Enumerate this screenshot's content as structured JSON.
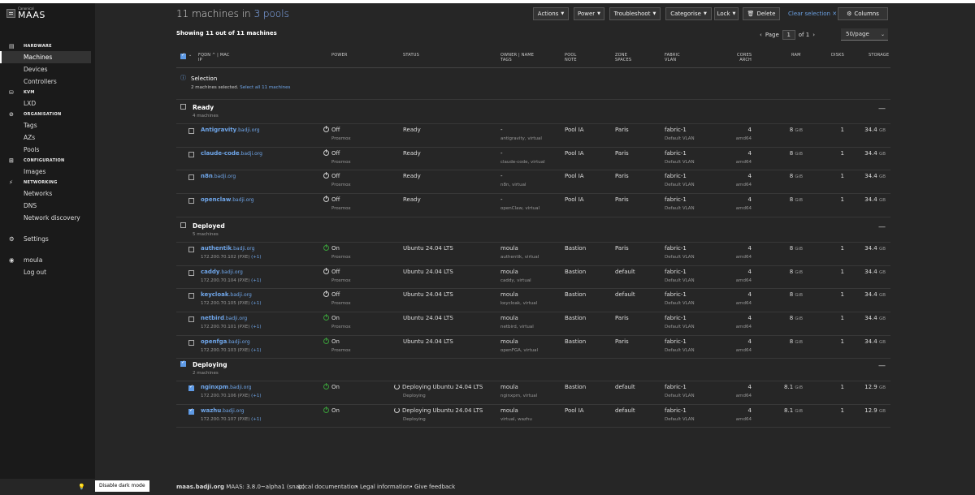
{
  "app": {
    "brand_small": "Canonical",
    "brand_big": "MAAS"
  },
  "sidebar": {
    "sections": [
      {
        "name": "hardware",
        "label": "HARDWARE",
        "icon": "server-icon",
        "items": [
          "Machines",
          "Devices",
          "Controllers"
        ]
      },
      {
        "name": "kvm",
        "label": "KVM",
        "icon": "kvm-icon",
        "items": [
          "LXD"
        ]
      },
      {
        "name": "organisation",
        "label": "ORGANISATION",
        "icon": "tag-icon",
        "items": [
          "Tags",
          "AZs",
          "Pools"
        ]
      },
      {
        "name": "configuration",
        "label": "CONFIGURATION",
        "icon": "config-icon",
        "items": [
          "Images"
        ]
      },
      {
        "name": "networking",
        "label": "NETWORKING",
        "icon": "network-icon",
        "items": [
          "Networks",
          "DNS",
          "Network discovery"
        ]
      }
    ],
    "settings": "Settings",
    "user": "moula",
    "logout": "Log out",
    "active": "Machines"
  },
  "header": {
    "title_pre": "11 machines in ",
    "title_link": "3 pools",
    "buttons": [
      "Actions",
      "Power",
      "Troubleshoot",
      "Categorise",
      "Lock"
    ],
    "delete": "Delete",
    "clear_selection": "Clear selection",
    "columns": "Columns"
  },
  "subheader": {
    "showing": "Showing 11 out of 11 machines",
    "page_label": "Page",
    "page_value": "1",
    "of_pages": "of 1",
    "per_page": "50/page"
  },
  "columns": {
    "fqdn": "FQDN",
    "mac": "| MAC",
    "ip": "IP",
    "power": "POWER",
    "status": "STATUS",
    "owner": "OWNER | NAME",
    "tags": "TAGS",
    "pool": "POOL",
    "note": "NOTE",
    "zone": "ZONE",
    "spaces": "SPACES",
    "fabric": "FABRIC",
    "vlan": "VLAN",
    "cores": "CORES",
    "arch": "ARCH",
    "ram": "RAM",
    "disks": "DISKS",
    "storage": "STORAGE"
  },
  "selection": {
    "title": "Selection",
    "text": "2 machines selected.",
    "link": "Select all 11 machines"
  },
  "groups": [
    {
      "name": "Ready",
      "count": "4 machines",
      "checked": false,
      "machines": [
        {
          "host": "Antigravity",
          "domain": ".badji.org",
          "ip": "",
          "power": "Off",
          "power_on": false,
          "power_type": "Proxmox",
          "status": "Ready",
          "status_sub": "",
          "deploying": false,
          "owner": "-",
          "tags": "antigravity, virtual",
          "pool": "Pool IA",
          "zone": "Paris",
          "fabric": "fabric-1",
          "vlan": "Default VLAN",
          "cores": "4",
          "arch": "amd64",
          "ram": "8",
          "ram_unit": "GiB",
          "disks": "1",
          "storage": "34.4",
          "storage_unit": "GB",
          "checked": false
        },
        {
          "host": "claude-code",
          "domain": ".badji.org",
          "ip": "",
          "power": "Off",
          "power_on": false,
          "power_type": "Proxmox",
          "status": "Ready",
          "status_sub": "",
          "deploying": false,
          "owner": "-",
          "tags": "claude-code, virtual",
          "pool": "Pool IA",
          "zone": "Paris",
          "fabric": "fabric-1",
          "vlan": "Default VLAN",
          "cores": "4",
          "arch": "amd64",
          "ram": "8",
          "ram_unit": "GiB",
          "disks": "1",
          "storage": "34.4",
          "storage_unit": "GB",
          "checked": false
        },
        {
          "host": "n8n",
          "domain": ".badji.org",
          "ip": "",
          "power": "Off",
          "power_on": false,
          "power_type": "Proxmox",
          "status": "Ready",
          "status_sub": "",
          "deploying": false,
          "owner": "-",
          "tags": "n8n, virtual",
          "pool": "Pool IA",
          "zone": "Paris",
          "fabric": "fabric-1",
          "vlan": "Default VLAN",
          "cores": "4",
          "arch": "amd64",
          "ram": "8",
          "ram_unit": "GiB",
          "disks": "1",
          "storage": "34.4",
          "storage_unit": "GB",
          "checked": false
        },
        {
          "host": "openclaw",
          "domain": ".badji.org",
          "ip": "",
          "power": "Off",
          "power_on": false,
          "power_type": "Proxmox",
          "status": "Ready",
          "status_sub": "",
          "deploying": false,
          "owner": "-",
          "tags": "openClaw, virtual",
          "pool": "Pool IA",
          "zone": "Paris",
          "fabric": "fabric-1",
          "vlan": "Default VLAN",
          "cores": "4",
          "arch": "amd64",
          "ram": "8",
          "ram_unit": "GiB",
          "disks": "1",
          "storage": "34.4",
          "storage_unit": "GB",
          "checked": false
        }
      ]
    },
    {
      "name": "Deployed",
      "count": "5 machines",
      "checked": false,
      "machines": [
        {
          "host": "authentik",
          "domain": ".badji.org",
          "ip": "172.200.70.102 (PXE)",
          "ip_extra": "(+1)",
          "power": "On",
          "power_on": true,
          "power_type": "Proxmox",
          "status": "Ubuntu 24.04 LTS",
          "status_sub": "",
          "deploying": false,
          "owner": "moula",
          "tags": "authentik, virtual",
          "pool": "Bastion",
          "zone": "Paris",
          "fabric": "fabric-1",
          "vlan": "Default VLAN",
          "cores": "4",
          "arch": "amd64",
          "ram": "8",
          "ram_unit": "GiB",
          "disks": "1",
          "storage": "34.4",
          "storage_unit": "GB",
          "checked": false
        },
        {
          "host": "caddy",
          "domain": ".badji.org",
          "ip": "172.200.70.104 (PXE)",
          "ip_extra": "(+1)",
          "power": "Off",
          "power_on": false,
          "power_type": "Proxmox",
          "status": "Ubuntu 24.04 LTS",
          "status_sub": "",
          "deploying": false,
          "owner": "moula",
          "tags": "caddy, virtual",
          "pool": "Bastion",
          "zone": "default",
          "fabric": "fabric-1",
          "vlan": "Default VLAN",
          "cores": "4",
          "arch": "amd64",
          "ram": "8",
          "ram_unit": "GiB",
          "disks": "1",
          "storage": "34.4",
          "storage_unit": "GB",
          "checked": false
        },
        {
          "host": "keycloak",
          "domain": ".badji.org",
          "ip": "172.200.70.105 (PXE)",
          "ip_extra": "(+1)",
          "power": "Off",
          "power_on": false,
          "power_type": "Proxmox",
          "status": "Ubuntu 24.04 LTS",
          "status_sub": "",
          "deploying": false,
          "owner": "moula",
          "tags": "keycloak, virtual",
          "pool": "Bastion",
          "zone": "default",
          "fabric": "fabric-1",
          "vlan": "Default VLAN",
          "cores": "4",
          "arch": "amd64",
          "ram": "8",
          "ram_unit": "GiB",
          "disks": "1",
          "storage": "34.4",
          "storage_unit": "GB",
          "checked": false
        },
        {
          "host": "netbird",
          "domain": ".badji.org",
          "ip": "172.200.70.101 (PXE)",
          "ip_extra": "(+1)",
          "power": "On",
          "power_on": true,
          "power_type": "Proxmox",
          "status": "Ubuntu 24.04 LTS",
          "status_sub": "",
          "deploying": false,
          "owner": "moula",
          "tags": "netbird, virtual",
          "pool": "Bastion",
          "zone": "Paris",
          "fabric": "fabric-1",
          "vlan": "Default VLAN",
          "cores": "4",
          "arch": "amd64",
          "ram": "8",
          "ram_unit": "GiB",
          "disks": "1",
          "storage": "34.4",
          "storage_unit": "GB",
          "checked": false
        },
        {
          "host": "openfga",
          "domain": ".badji.org",
          "ip": "172.200.70.103 (PXE)",
          "ip_extra": "(+1)",
          "power": "On",
          "power_on": true,
          "power_type": "Proxmox",
          "status": "Ubuntu 24.04 LTS",
          "status_sub": "",
          "deploying": false,
          "owner": "moula",
          "tags": "openFGA, virtual",
          "pool": "Bastion",
          "zone": "Paris",
          "fabric": "fabric-1",
          "vlan": "Default VLAN",
          "cores": "4",
          "arch": "amd64",
          "ram": "8",
          "ram_unit": "GiB",
          "disks": "1",
          "storage": "34.4",
          "storage_unit": "GB",
          "checked": false
        }
      ]
    },
    {
      "name": "Deploying",
      "count": "2 machines",
      "checked": true,
      "machines": [
        {
          "host": "nginxpm",
          "domain": ".badji.org",
          "ip": "172.200.70.106 (PXE)",
          "ip_extra": "(+1)",
          "power": "On",
          "power_on": true,
          "power_type": "",
          "status": "Deploying Ubuntu 24.04 LTS",
          "status_sub": "Deploying",
          "deploying": true,
          "owner": "moula",
          "tags": "nginxpm, virtual",
          "pool": "Bastion",
          "zone": "default",
          "fabric": "fabric-1",
          "vlan": "Default VLAN",
          "cores": "4",
          "arch": "amd64",
          "ram": "8.1",
          "ram_unit": "GiB",
          "disks": "1",
          "storage": "12.9",
          "storage_unit": "GB",
          "checked": true
        },
        {
          "host": "wazhu",
          "domain": ".badji.org",
          "ip": "172.200.70.107 (PXE)",
          "ip_extra": "(+1)",
          "power": "On",
          "power_on": true,
          "power_type": "",
          "status": "Deploying Ubuntu 24.04 LTS",
          "status_sub": "Deploying",
          "deploying": true,
          "owner": "moula",
          "tags": "virtual, wazhu",
          "pool": "Pool IA",
          "zone": "default",
          "fabric": "fabric-1",
          "vlan": "Default VLAN",
          "cores": "4",
          "arch": "amd64",
          "ram": "8.1",
          "ram_unit": "GiB",
          "disks": "1",
          "storage": "12.9",
          "storage_unit": "GB",
          "checked": true
        }
      ]
    }
  ],
  "footer": {
    "host": "maas.badji.org",
    "version": "MAAS: 3.8.0~alpha1 (snap)",
    "links": [
      "Local documentation",
      "Legal information",
      "Give feedback"
    ],
    "tooltip": "Disable dark mode"
  }
}
